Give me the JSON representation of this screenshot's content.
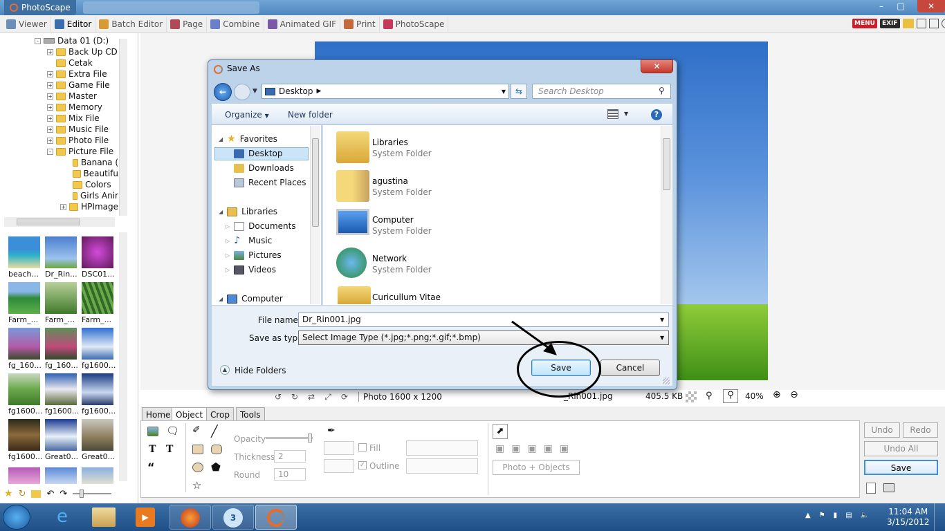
{
  "app": {
    "title": "PhotoScape"
  },
  "toolbar": {
    "tabs": [
      "Viewer",
      "Editor",
      "Batch Editor",
      "Page",
      "Combine",
      "Animated GIF",
      "Print",
      "PhotoScape"
    ],
    "right_badges": [
      "MENU",
      "EXIF"
    ]
  },
  "tree": {
    "drive": "Data 01 (D:)",
    "folders": [
      "Back Up CD",
      "Cetak",
      "Extra File",
      "Game File",
      "Master",
      "Memory",
      "Mix File",
      "Music File",
      "Photo File",
      "Picture File"
    ],
    "subfolders": [
      "Banana (",
      "Beautifu",
      "Colors",
      "Girls Anir",
      "HPImage"
    ]
  },
  "thumbnails": [
    "beach...",
    "Dr_Rin...",
    "DSC01...",
    "Farm_...",
    "Farm_...",
    "Farm_...",
    "fg_160...",
    "fg_160...",
    "fg1600...",
    "fg1600...",
    "fg1600...",
    "fg1600...",
    "fg1600...",
    "Great0...",
    "Great0..."
  ],
  "status": {
    "photo_size": "Photo 1600 x 1200",
    "filename": "_Rin001.jpg",
    "filesize": "405.5 KB",
    "zoom": "40%"
  },
  "panel": {
    "tabs": [
      "Home",
      "Object",
      "Crop",
      "Tools"
    ],
    "opacity_label": "Opacity",
    "thickness_label": "Thickness",
    "thickness_value": "2",
    "round_label": "Round",
    "round_value": "10",
    "fill_label": "Fill",
    "outline_label": "Outline",
    "photo_objects_label": "Photo + Objects",
    "undo_label": "Undo",
    "redo_label": "Redo",
    "undo_all_label": "Undo All",
    "save_label": "Save"
  },
  "dialog": {
    "title": "Save As",
    "address": "Desktop",
    "search_placeholder": "Search Desktop",
    "organize_label": "Organize",
    "new_folder_label": "New folder",
    "nav": {
      "favorites": "Favorites",
      "favorites_items": [
        "Desktop",
        "Downloads",
        "Recent Places"
      ],
      "libraries": "Libraries",
      "libraries_items": [
        "Documents",
        "Music",
        "Pictures",
        "Videos"
      ],
      "computer": "Computer"
    },
    "files": [
      {
        "name": "Libraries",
        "type": "System Folder"
      },
      {
        "name": "agustina",
        "type": "System Folder"
      },
      {
        "name": "Computer",
        "type": "System Folder"
      },
      {
        "name": "Network",
        "type": "System Folder"
      },
      {
        "name": "Curicullum Vitae",
        "type": ""
      }
    ],
    "filename_label": "File name:",
    "filename_value": "Dr_Rin001.jpg",
    "savetype_label": "Save as type:",
    "savetype_value": "Select Image Type  (*.jpg;*.png;*.gif;*.bmp)",
    "hide_folders_label": "Hide Folders",
    "save_label": "Save",
    "cancel_label": "Cancel"
  },
  "clock": {
    "time": "11:04 AM",
    "date": "3/15/2012"
  }
}
